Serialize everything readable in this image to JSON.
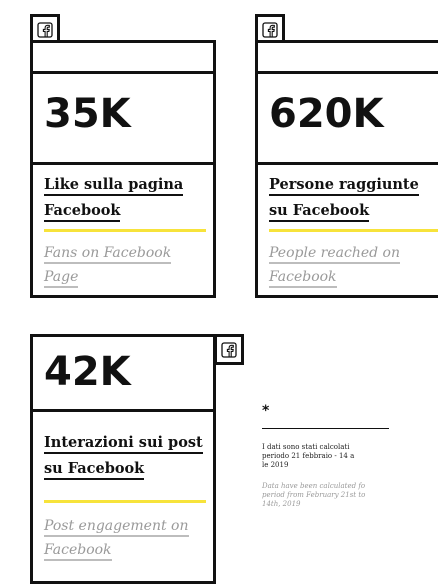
{
  "cards": [
    {
      "icon": "facebook-icon",
      "value": "35K",
      "it_line1": "Like sulla pagina",
      "it_line2": "Facebook",
      "en_line1": "Fans on Facebook",
      "en_line2": "Page"
    },
    {
      "icon": "facebook-icon",
      "value": "620K",
      "it_line1": "Persone raggiunte",
      "it_line2": "su Facebook",
      "en_line1": "People reached on",
      "en_line2": "Facebook"
    },
    {
      "icon": "facebook-icon",
      "value": "42K",
      "it_line1": "Interazioni sui post",
      "it_line2": "su Facebook",
      "en_line1": "Post engagement on",
      "en_line2": "Facebook"
    }
  ],
  "note": {
    "marker": "*",
    "it_line1": "I dati sono stati calcolati",
    "it_line2": "periodo 21 febbraio - 14 a",
    "it_line3": "le 2019",
    "en_line1": "Data have been calculated fo",
    "en_line2": "period from February 21st to ",
    "en_line3": "14th, 2019"
  },
  "colors": {
    "border": "#111111",
    "accent_yellow": "#f7e33b",
    "english_text": "#9a9a9a"
  }
}
